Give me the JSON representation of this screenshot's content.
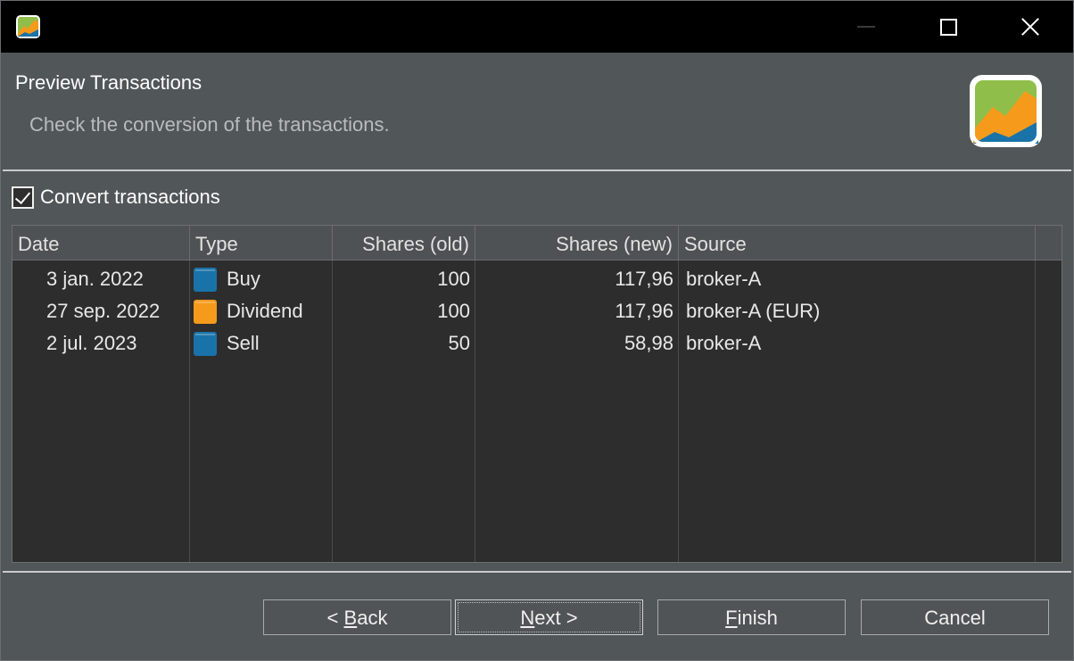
{
  "window": {
    "icon": "portfolio-chart-icon",
    "controls": {
      "minimize": "minimize-icon",
      "maximize": "maximize-icon",
      "close": "close-icon"
    }
  },
  "header": {
    "title": "Preview Transactions",
    "description": "Check the conversion of the transactions.",
    "logo": "portfolio-chart-icon"
  },
  "convert": {
    "label": "Convert transactions",
    "checked": true
  },
  "table": {
    "columns": [
      "Date",
      "Type",
      "Shares (old)",
      "Shares (new)",
      "Source"
    ],
    "rows": [
      {
        "date": "3 jan. 2022",
        "type": "Buy",
        "type_color": "#1a73a8",
        "shares_old": "100",
        "shares_new": "117,96",
        "source": "broker-A"
      },
      {
        "date": "27 sep. 2022",
        "type": "Dividend",
        "type_color": "#f59a1b",
        "shares_old": "100",
        "shares_new": "117,96",
        "source": "broker-A (EUR)"
      },
      {
        "date": "2 jul. 2023",
        "type": "Sell",
        "type_color": "#1a73a8",
        "shares_old": "50",
        "shares_new": "58,98",
        "source": "broker-A"
      }
    ]
  },
  "buttons": {
    "back": {
      "prefix": "< ",
      "mnemonic": "B",
      "rest": "ack"
    },
    "next": {
      "mnemonic": "N",
      "rest": "ext >"
    },
    "finish": {
      "mnemonic": "F",
      "rest": "inish"
    },
    "cancel": "Cancel"
  },
  "colors": {
    "accent_green": "#8fbf4a",
    "accent_orange": "#f59a1b",
    "accent_blue": "#1a73a8"
  }
}
